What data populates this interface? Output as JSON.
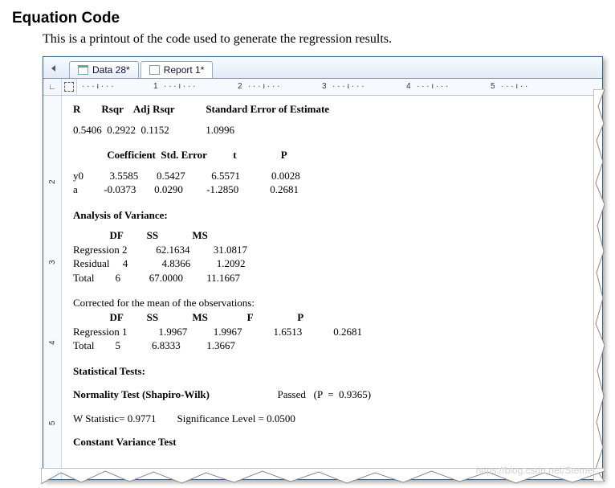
{
  "heading": "Equation Code",
  "intro": "This is a printout of the code used to generate the regression results.",
  "tabs": {
    "data": "Data 28*",
    "report": "Report 1*"
  },
  "ruler_numbers": [
    "1",
    "2",
    "3",
    "4",
    "5"
  ],
  "vruler_numbers": [
    "2",
    "3",
    "4",
    "5"
  ],
  "stats_header": {
    "R": "R",
    "Rsqr": "Rsqr",
    "AdjRsqr": "Adj Rsqr",
    "SEE": "Standard Error of Estimate"
  },
  "stats_row": {
    "R": "0.5406",
    "Rsqr": "0.2922",
    "AdjRsqr": "0.1152",
    "SEE": "1.0996"
  },
  "coef_header": {
    "c": "Coefficient",
    "se": "Std. Error",
    "t": "t",
    "P": "P"
  },
  "coef_rows": [
    {
      "name": "y0",
      "c": "3.5585",
      "se": "0.5427",
      "t": "6.5571",
      "P": "0.0028"
    },
    {
      "name": "a",
      "c": "-0.0373",
      "se": "0.0290",
      "t": "-1.2850",
      "P": "0.2681"
    }
  ],
  "aov_title": "Analysis of Variance:",
  "aov_header": {
    "DF": "DF",
    "SS": "SS",
    "MS": "MS"
  },
  "aov_rows": [
    {
      "name": "Regression",
      "DF": "2",
      "SS": "62.1634",
      "MS": "31.0817"
    },
    {
      "name": "Residual",
      "DF": "4",
      "SS": "4.8366",
      "MS": "1.2092"
    },
    {
      "name": "Total",
      "DF": "6",
      "SS": "67.0000",
      "MS": "11.1667"
    }
  ],
  "corr_title": "Corrected for the mean of the observations:",
  "corr_header": {
    "DF": "DF",
    "SS": "SS",
    "MS": "MS",
    "F": "F",
    "P": "P"
  },
  "corr_rows": [
    {
      "name": "Regression",
      "DF": "1",
      "SS": "1.9967",
      "MS": "1.9967",
      "F": "1.6513",
      "P": "0.2681"
    },
    {
      "name": "Total",
      "DF": "5",
      "SS": "6.8333",
      "MS": "1.3667",
      "F": "",
      "P": ""
    }
  ],
  "stat_tests": "Statistical Tests:",
  "normality": {
    "label": "Normality Test (Shapiro-Wilk)",
    "result": "Passed   (P  =  0.9365)"
  },
  "wline": {
    "w": "W Statistic= 0.9771",
    "sig": "Significance Level = 0.0500"
  },
  "cvt": "Constant Variance Test",
  "watermark": "https://blog.csdn.net/Stemer"
}
